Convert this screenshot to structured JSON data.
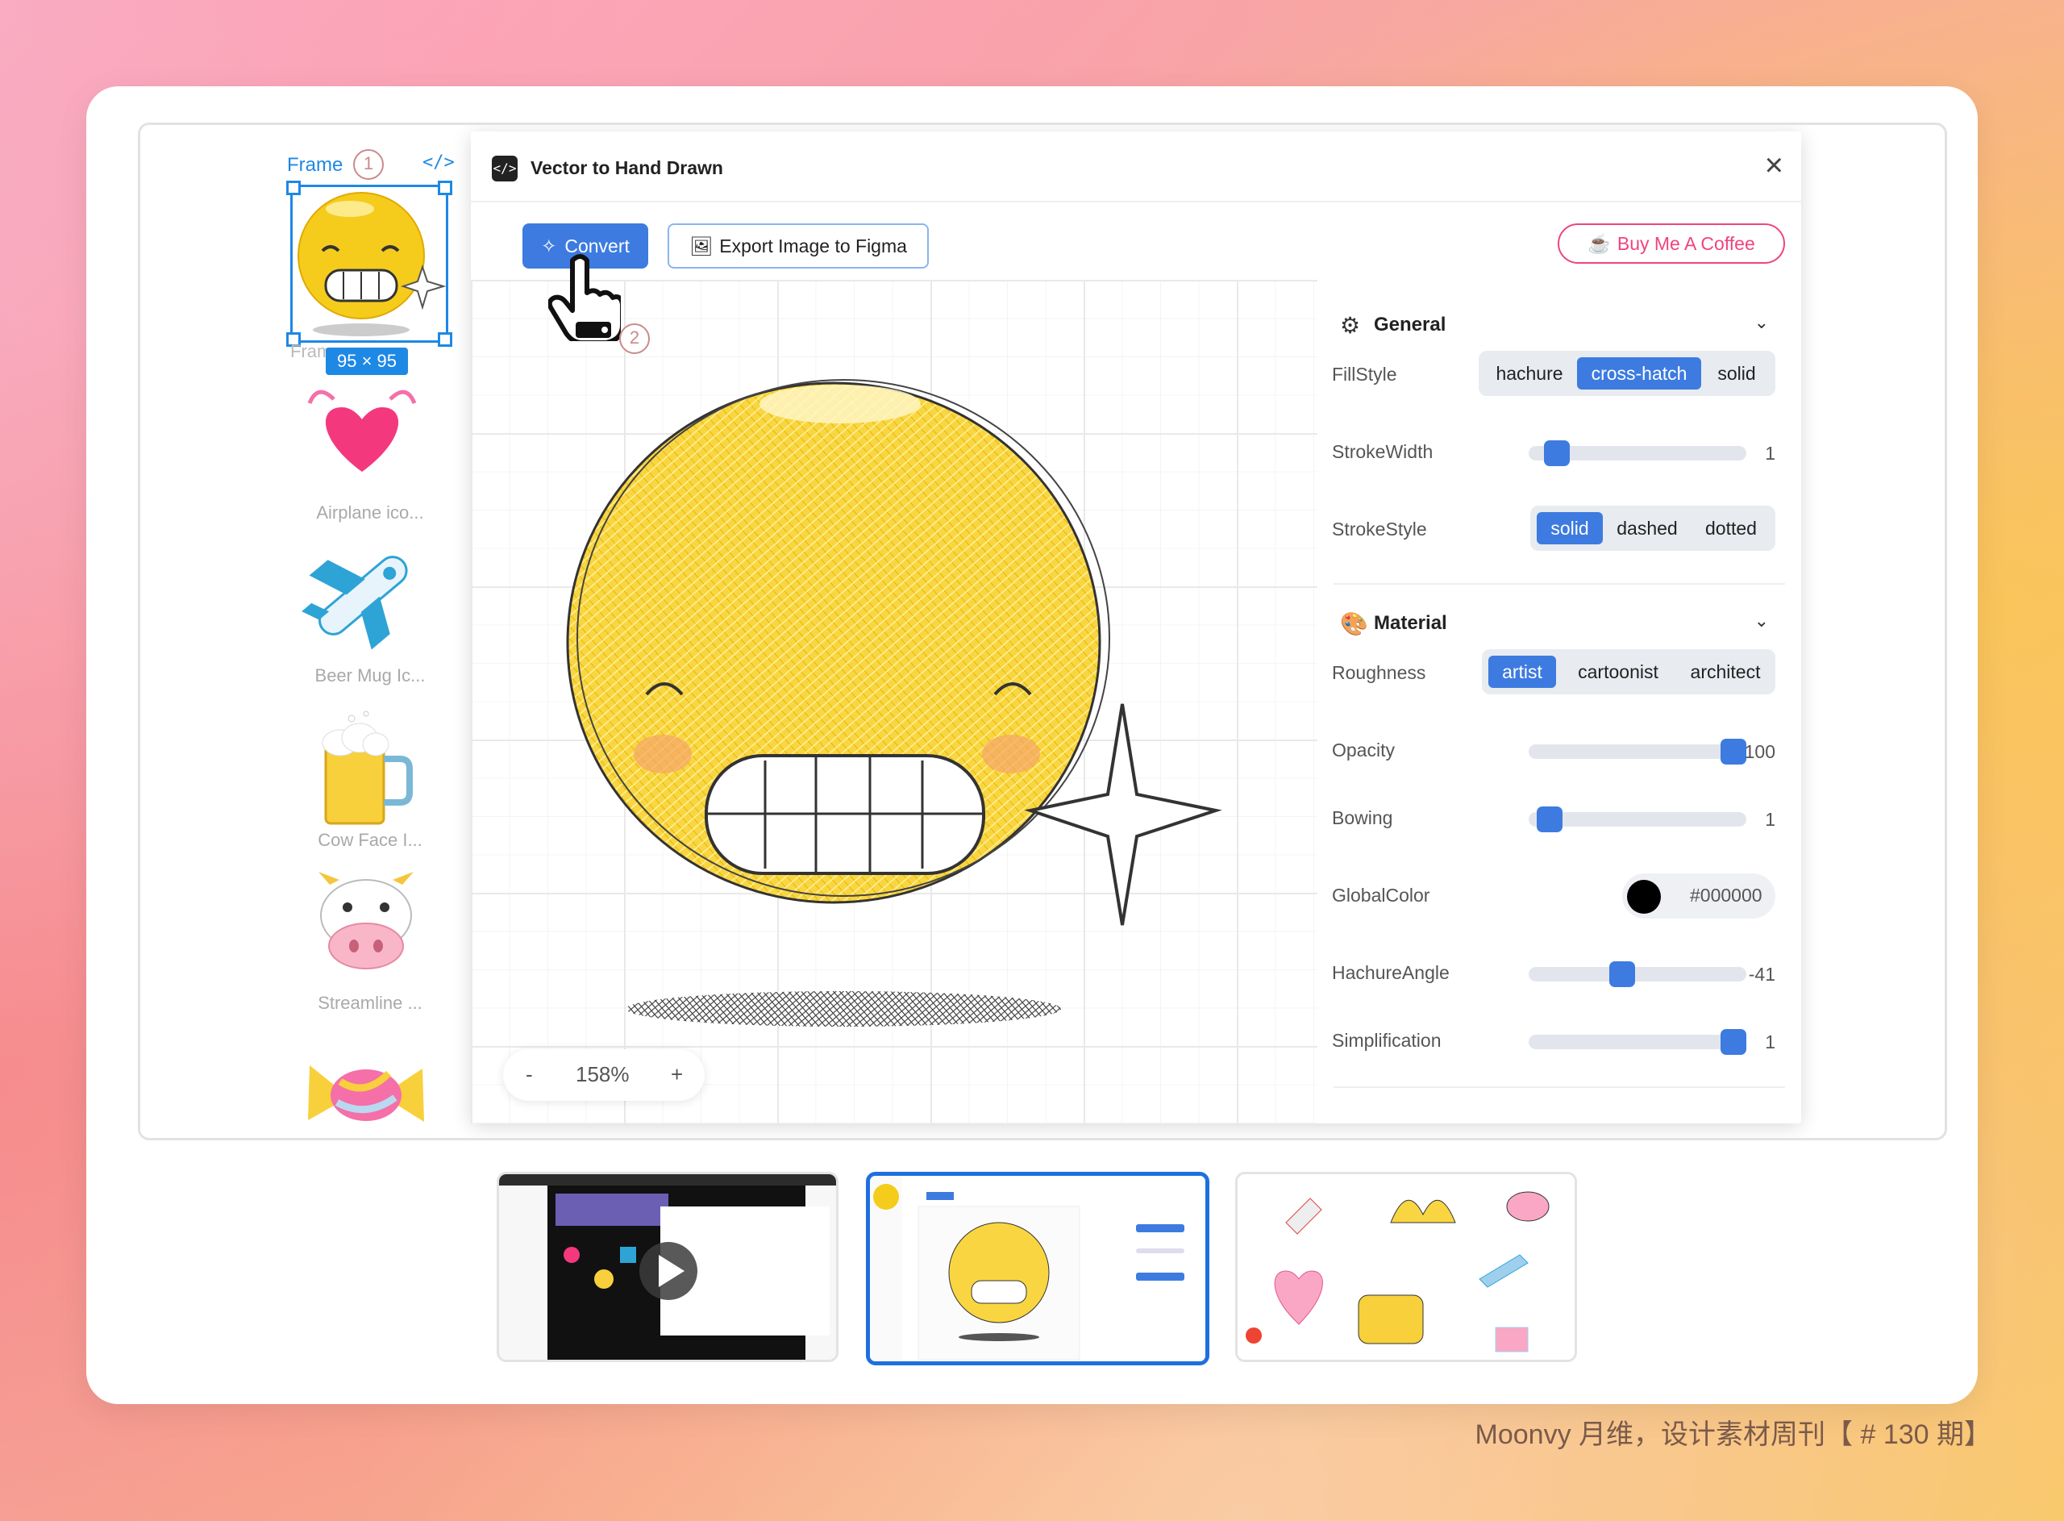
{
  "layers": {
    "frame_label": "Frame",
    "step_one": "1",
    "code_icon": "</>",
    "size_badge": "95 × 95",
    "frame_underlabel": "Frame",
    "items": [
      {
        "name": "Airplane ico..."
      },
      {
        "name": "Beer Mug Ic..."
      },
      {
        "name": "Cow Face I..."
      },
      {
        "name": "Streamline ..."
      }
    ]
  },
  "dialog": {
    "logo_icon": "</>",
    "title": "Vector to Hand Drawn",
    "close_icon": "×",
    "convert_label": "Convert",
    "export_label": "Export Image to Figma",
    "coffee_label": "Buy Me A Coffee",
    "step_two": "2",
    "zoom": {
      "minus": "-",
      "value": "158%",
      "plus": "+"
    }
  },
  "settings": {
    "general": {
      "title": "General",
      "chevron": "⌄",
      "fillstyle": {
        "label": "FillStyle",
        "options": [
          "hachure",
          "cross-hatch",
          "solid"
        ],
        "selected": "cross-hatch"
      },
      "strokewidth": {
        "label": "StrokeWidth",
        "value": "1",
        "fraction": 0.08
      },
      "strokestyle": {
        "label": "StrokeStyle",
        "options": [
          "solid",
          "dashed",
          "dotted"
        ],
        "selected": "solid"
      }
    },
    "material": {
      "title": "Material",
      "chevron": "⌄",
      "roughness": {
        "label": "Roughness",
        "options": [
          "artist",
          "cartoonist",
          "architect"
        ],
        "selected": "artist"
      },
      "opacity": {
        "label": "Opacity",
        "value": "100",
        "fraction": 1.0
      },
      "bowing": {
        "label": "Bowing",
        "value": "1",
        "fraction": 0.04
      },
      "globalcolor": {
        "label": "GlobalColor",
        "value": "#000000"
      },
      "hachureangle": {
        "label": "HachureAngle",
        "value": "-41",
        "fraction": 0.42
      },
      "simplification": {
        "label": "Simplification",
        "value": "1",
        "fraction": 1.0
      }
    }
  },
  "colors": {
    "accent": "#3d7be0",
    "coffee": "#f0447e",
    "selection": "#1e88e5"
  },
  "footer": "Moonvy 月维，设计素材周刊【 # 130 期】"
}
